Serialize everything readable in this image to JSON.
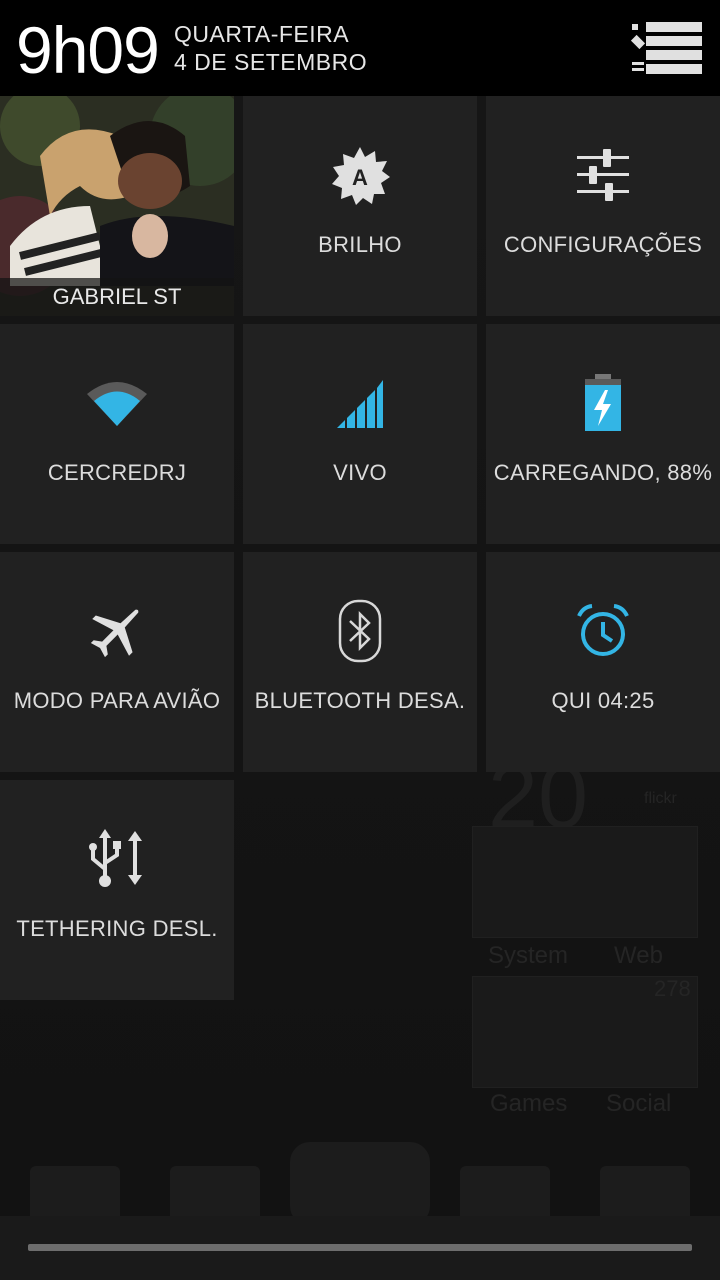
{
  "status_header": {
    "time": "9h09",
    "weekday": "QUARTA-FEIRA",
    "date": "4 DE SETEMBRO",
    "menu_icon": "list-settings-icon"
  },
  "tiles": [
    {
      "id": "user",
      "label": "GABRIEL ST",
      "icon": "user-photo"
    },
    {
      "id": "brightness",
      "label": "BRILHO",
      "icon": "auto-brightness-icon"
    },
    {
      "id": "settings",
      "label": "CONFIGURAÇÕES",
      "icon": "sliders-icon"
    },
    {
      "id": "wifi",
      "label": "CERCREDRJ",
      "icon": "wifi-icon"
    },
    {
      "id": "signal",
      "label": "VIVO",
      "icon": "signal-bars-icon"
    },
    {
      "id": "battery",
      "label": "CARREGANDO, 88%",
      "icon": "battery-charging-icon",
      "level": 0.88
    },
    {
      "id": "airplane",
      "label": "MODO PARA AVIÃO",
      "icon": "airplane-icon"
    },
    {
      "id": "bluetooth",
      "label": "BLUETOOTH DESA.",
      "icon": "bluetooth-icon"
    },
    {
      "id": "alarm",
      "label": "QUI 04:25",
      "icon": "alarm-clock-icon"
    },
    {
      "id": "tethering",
      "label": "TETHERING DESL.",
      "icon": "usb-tether-icon"
    }
  ],
  "colors": {
    "accent_blue": "#33b5e5",
    "tile_bg": "#222222",
    "header_bg": "#000000",
    "label_text": "#dcdcdc"
  },
  "background_home": {
    "folder_labels": [
      "System",
      "Web",
      "Games",
      "Social"
    ],
    "clock_fragment": "20",
    "widget_label": "flickr",
    "badge": "278"
  }
}
